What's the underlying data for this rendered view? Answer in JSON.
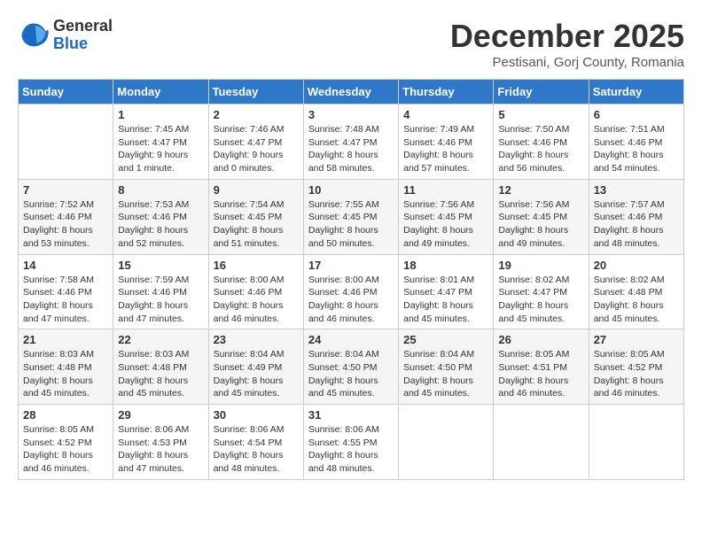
{
  "header": {
    "logo": {
      "general": "General",
      "blue": "Blue"
    },
    "title": "December 2025",
    "location": "Pestisani, Gorj County, Romania"
  },
  "weekdays": [
    "Sunday",
    "Monday",
    "Tuesday",
    "Wednesday",
    "Thursday",
    "Friday",
    "Saturday"
  ],
  "weeks": [
    [
      {
        "day": "",
        "sunrise": "",
        "sunset": "",
        "daylight": ""
      },
      {
        "day": "1",
        "sunrise": "Sunrise: 7:45 AM",
        "sunset": "Sunset: 4:47 PM",
        "daylight": "Daylight: 9 hours and 1 minute."
      },
      {
        "day": "2",
        "sunrise": "Sunrise: 7:46 AM",
        "sunset": "Sunset: 4:47 PM",
        "daylight": "Daylight: 9 hours and 0 minutes."
      },
      {
        "day": "3",
        "sunrise": "Sunrise: 7:48 AM",
        "sunset": "Sunset: 4:47 PM",
        "daylight": "Daylight: 8 hours and 58 minutes."
      },
      {
        "day": "4",
        "sunrise": "Sunrise: 7:49 AM",
        "sunset": "Sunset: 4:46 PM",
        "daylight": "Daylight: 8 hours and 57 minutes."
      },
      {
        "day": "5",
        "sunrise": "Sunrise: 7:50 AM",
        "sunset": "Sunset: 4:46 PM",
        "daylight": "Daylight: 8 hours and 56 minutes."
      },
      {
        "day": "6",
        "sunrise": "Sunrise: 7:51 AM",
        "sunset": "Sunset: 4:46 PM",
        "daylight": "Daylight: 8 hours and 54 minutes."
      }
    ],
    [
      {
        "day": "7",
        "sunrise": "Sunrise: 7:52 AM",
        "sunset": "Sunset: 4:46 PM",
        "daylight": "Daylight: 8 hours and 53 minutes."
      },
      {
        "day": "8",
        "sunrise": "Sunrise: 7:53 AM",
        "sunset": "Sunset: 4:46 PM",
        "daylight": "Daylight: 8 hours and 52 minutes."
      },
      {
        "day": "9",
        "sunrise": "Sunrise: 7:54 AM",
        "sunset": "Sunset: 4:45 PM",
        "daylight": "Daylight: 8 hours and 51 minutes."
      },
      {
        "day": "10",
        "sunrise": "Sunrise: 7:55 AM",
        "sunset": "Sunset: 4:45 PM",
        "daylight": "Daylight: 8 hours and 50 minutes."
      },
      {
        "day": "11",
        "sunrise": "Sunrise: 7:56 AM",
        "sunset": "Sunset: 4:45 PM",
        "daylight": "Daylight: 8 hours and 49 minutes."
      },
      {
        "day": "12",
        "sunrise": "Sunrise: 7:56 AM",
        "sunset": "Sunset: 4:45 PM",
        "daylight": "Daylight: 8 hours and 49 minutes."
      },
      {
        "day": "13",
        "sunrise": "Sunrise: 7:57 AM",
        "sunset": "Sunset: 4:46 PM",
        "daylight": "Daylight: 8 hours and 48 minutes."
      }
    ],
    [
      {
        "day": "14",
        "sunrise": "Sunrise: 7:58 AM",
        "sunset": "Sunset: 4:46 PM",
        "daylight": "Daylight: 8 hours and 47 minutes."
      },
      {
        "day": "15",
        "sunrise": "Sunrise: 7:59 AM",
        "sunset": "Sunset: 4:46 PM",
        "daylight": "Daylight: 8 hours and 47 minutes."
      },
      {
        "day": "16",
        "sunrise": "Sunrise: 8:00 AM",
        "sunset": "Sunset: 4:46 PM",
        "daylight": "Daylight: 8 hours and 46 minutes."
      },
      {
        "day": "17",
        "sunrise": "Sunrise: 8:00 AM",
        "sunset": "Sunset: 4:46 PM",
        "daylight": "Daylight: 8 hours and 46 minutes."
      },
      {
        "day": "18",
        "sunrise": "Sunrise: 8:01 AM",
        "sunset": "Sunset: 4:47 PM",
        "daylight": "Daylight: 8 hours and 45 minutes."
      },
      {
        "day": "19",
        "sunrise": "Sunrise: 8:02 AM",
        "sunset": "Sunset: 4:47 PM",
        "daylight": "Daylight: 8 hours and 45 minutes."
      },
      {
        "day": "20",
        "sunrise": "Sunrise: 8:02 AM",
        "sunset": "Sunset: 4:48 PM",
        "daylight": "Daylight: 8 hours and 45 minutes."
      }
    ],
    [
      {
        "day": "21",
        "sunrise": "Sunrise: 8:03 AM",
        "sunset": "Sunset: 4:48 PM",
        "daylight": "Daylight: 8 hours and 45 minutes."
      },
      {
        "day": "22",
        "sunrise": "Sunrise: 8:03 AM",
        "sunset": "Sunset: 4:48 PM",
        "daylight": "Daylight: 8 hours and 45 minutes."
      },
      {
        "day": "23",
        "sunrise": "Sunrise: 8:04 AM",
        "sunset": "Sunset: 4:49 PM",
        "daylight": "Daylight: 8 hours and 45 minutes."
      },
      {
        "day": "24",
        "sunrise": "Sunrise: 8:04 AM",
        "sunset": "Sunset: 4:50 PM",
        "daylight": "Daylight: 8 hours and 45 minutes."
      },
      {
        "day": "25",
        "sunrise": "Sunrise: 8:04 AM",
        "sunset": "Sunset: 4:50 PM",
        "daylight": "Daylight: 8 hours and 45 minutes."
      },
      {
        "day": "26",
        "sunrise": "Sunrise: 8:05 AM",
        "sunset": "Sunset: 4:51 PM",
        "daylight": "Daylight: 8 hours and 46 minutes."
      },
      {
        "day": "27",
        "sunrise": "Sunrise: 8:05 AM",
        "sunset": "Sunset: 4:52 PM",
        "daylight": "Daylight: 8 hours and 46 minutes."
      }
    ],
    [
      {
        "day": "28",
        "sunrise": "Sunrise: 8:05 AM",
        "sunset": "Sunset: 4:52 PM",
        "daylight": "Daylight: 8 hours and 46 minutes."
      },
      {
        "day": "29",
        "sunrise": "Sunrise: 8:06 AM",
        "sunset": "Sunset: 4:53 PM",
        "daylight": "Daylight: 8 hours and 47 minutes."
      },
      {
        "day": "30",
        "sunrise": "Sunrise: 8:06 AM",
        "sunset": "Sunset: 4:54 PM",
        "daylight": "Daylight: 8 hours and 48 minutes."
      },
      {
        "day": "31",
        "sunrise": "Sunrise: 8:06 AM",
        "sunset": "Sunset: 4:55 PM",
        "daylight": "Daylight: 8 hours and 48 minutes."
      },
      {
        "day": "",
        "sunrise": "",
        "sunset": "",
        "daylight": ""
      },
      {
        "day": "",
        "sunrise": "",
        "sunset": "",
        "daylight": ""
      },
      {
        "day": "",
        "sunrise": "",
        "sunset": "",
        "daylight": ""
      }
    ]
  ]
}
